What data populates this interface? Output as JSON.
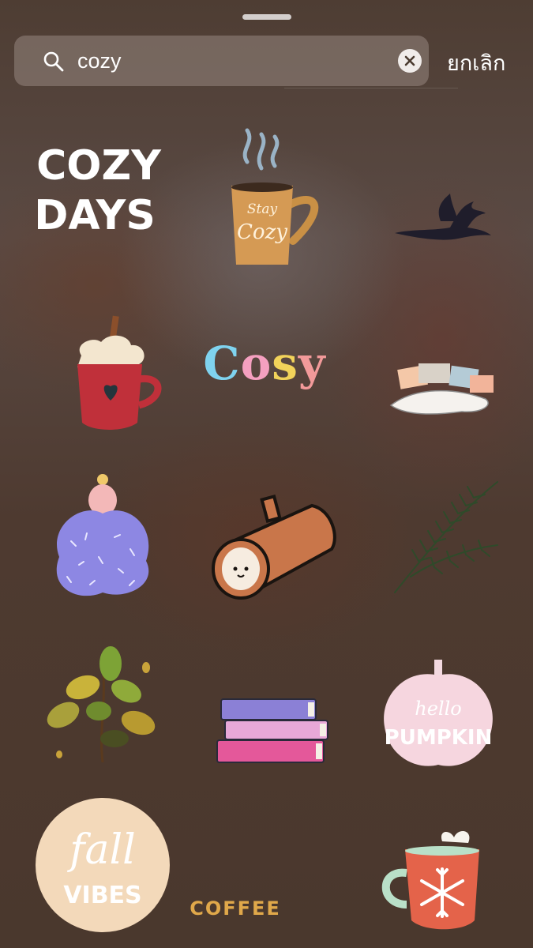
{
  "search": {
    "value": "cozy",
    "cancel_label": "ยกเลิก"
  },
  "stickers": {
    "cozy_days": {
      "line1": "COZY",
      "line2": "DAYS"
    },
    "stay_cozy_mug": {
      "line1": "Stay",
      "line2": "Cozy"
    },
    "cosy": {
      "c": "C",
      "o": "o",
      "s": "s",
      "y": "y"
    },
    "fall_vibes": {
      "line1": "fall",
      "line2": "VIBES"
    },
    "hello_pumpkin": {
      "line1": "hello",
      "line2": "PUMPKIN"
    },
    "coffee": {
      "label": "COFFEE"
    }
  },
  "colors": {
    "cosy_c": "#7fd3ef",
    "cosy_o": "#f5a0c0",
    "cosy_s": "#f2d35a",
    "cosy_y": "#f29a9a"
  },
  "icons": {
    "search": "search-icon",
    "clear": "clear-icon"
  }
}
